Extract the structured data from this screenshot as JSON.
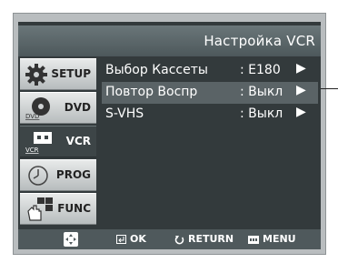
{
  "title": "Настройка VCR",
  "tabs": [
    {
      "label": "SETUP",
      "icon": "gear-icon"
    },
    {
      "label": "DVD",
      "icon": "disc-icon",
      "icon_text": "DVD"
    },
    {
      "label": "VCR",
      "icon": "cassette-icon",
      "icon_text": "VCR",
      "active": true
    },
    {
      "label": "PROG",
      "icon": "clock-icon"
    },
    {
      "label": "FUNC",
      "icon": "hand-icon"
    }
  ],
  "menu": [
    {
      "name": "Выбор Кассеты",
      "value": ": E180",
      "arrow": "▶"
    },
    {
      "name": "Повтор Воспр",
      "value": ": Выкл",
      "arrow": "▶",
      "selected": true
    },
    {
      "name": "S-VHS",
      "value": ": Выкл",
      "arrow": "▶"
    }
  ],
  "footer": {
    "ok_label": "OK",
    "return_label": "RETURN",
    "menu_label": "MENU"
  },
  "colors": {
    "screen_bg": "#333a3c",
    "selected_row": "#5a6366",
    "frame": "#b9bdbf"
  }
}
